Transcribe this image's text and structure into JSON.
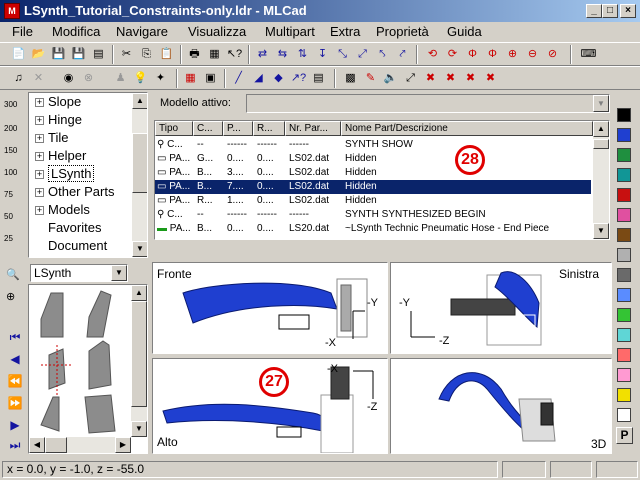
{
  "window": {
    "title": "LSynth_Tutorial_Constraints-only.ldr - MLCad",
    "min_label": "_",
    "max_label": "□",
    "close_label": "×"
  },
  "menu": [
    "File",
    "Modifica",
    "Navigare",
    "Visualizza",
    "Multipart",
    "Extra",
    "Proprietà",
    "Guida"
  ],
  "tree": {
    "items": [
      {
        "label": "Slope",
        "expandable": true
      },
      {
        "label": "Hinge",
        "expandable": true
      },
      {
        "label": "Tile",
        "expandable": true
      },
      {
        "label": "Helper",
        "expandable": true
      },
      {
        "label": "LSynth",
        "expandable": true
      },
      {
        "label": "Other Parts",
        "expandable": true
      },
      {
        "label": "Models",
        "expandable": true
      },
      {
        "label": "Favorites",
        "expandable": false
      },
      {
        "label": "Document",
        "expandable": false
      }
    ],
    "plus": "+",
    "zoom_labels": [
      "300",
      "200",
      "150",
      "100",
      "75",
      "50",
      "25"
    ]
  },
  "part_dropdown": {
    "value": "LSynth",
    "arrow": "▼"
  },
  "model": {
    "label": "Modello attivo:",
    "value": ""
  },
  "table": {
    "headers": [
      "Tipo",
      "C...",
      "P...",
      "R...",
      "Nr. Par...",
      "Nome Part/Descrizione"
    ],
    "rows": [
      [
        "C...",
        "--",
        "------",
        "------",
        "------",
        "SYNTH SHOW"
      ],
      [
        "PA...",
        "G...",
        "0....",
        "0....",
        "LS02.dat",
        "Hidden"
      ],
      [
        "PA...",
        "B...",
        "3....",
        "0....",
        "LS02.dat",
        "Hidden"
      ],
      [
        "PA...",
        "B...",
        "7....",
        "0....",
        "LS02.dat",
        "Hidden"
      ],
      [
        "PA...",
        "R...",
        "1....",
        "0....",
        "LS02.dat",
        "Hidden"
      ],
      [
        "C...",
        "--",
        "------",
        "------",
        "------",
        "SYNTH SYNTHESIZED BEGIN"
      ],
      [
        "PA...",
        "B...",
        "0....",
        "0....",
        "LS20.dat",
        "~LSynth Technic Pneumatic Hose - End Piece"
      ]
    ],
    "selected_row": 3
  },
  "annotations": {
    "a": "28",
    "b": "27"
  },
  "views": {
    "front": {
      "label": "Fronte",
      "axis_y": "-Y",
      "axis_x": "-X"
    },
    "left": {
      "label": "Sinistra",
      "axis_y": "-Y",
      "axis_z": "-Z"
    },
    "top": {
      "label": "Alto",
      "axis_x": "-X",
      "axis_z": "-Z"
    },
    "iso": {
      "label": "3D"
    }
  },
  "palette": {
    "colors": [
      "#000000",
      "#1f3fd0",
      "#1f8f3f",
      "#119696",
      "#c81010",
      "#e050a0",
      "#7a4a14",
      "#b0b0b0",
      "#6a6a6a",
      "#5a8cff",
      "#34c434",
      "#5fd6d6",
      "#ff6a6a",
      "#ff9ad2",
      "#f2e000",
      "#ffffff"
    ],
    "picker_label": "P"
  },
  "status": {
    "coords": "x = 0.0, y = -1.0, z = -55.0"
  }
}
